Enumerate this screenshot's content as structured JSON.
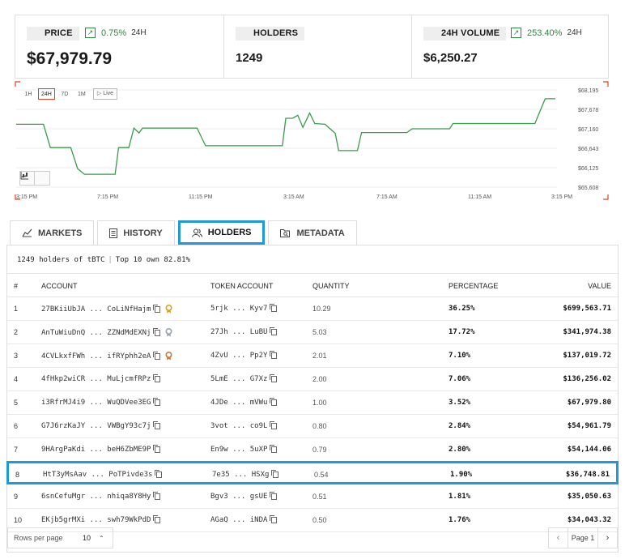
{
  "stats": {
    "price": {
      "label": "PRICE",
      "change": "0.75%",
      "period": "24H",
      "value": "$67,979.79"
    },
    "holders": {
      "label": "HOLDERS",
      "value": "1249"
    },
    "volume": {
      "label": "24H VOLUME",
      "change": "253.40%",
      "period": "24H",
      "value": "$6,250.27"
    }
  },
  "chart_controls": {
    "ranges": [
      "1H",
      "24H",
      "7D",
      "1M"
    ],
    "active_range": "24H",
    "live_label": "Live"
  },
  "chart_data": {
    "type": "line",
    "title": "",
    "xlabel": "",
    "ylabel": "",
    "x_tick_labels": [
      "3:15 PM",
      "7:15 PM",
      "11:15 PM",
      "3:15 AM",
      "7:15 AM",
      "11:15 AM",
      "3:15 PM"
    ],
    "y_tick_labels": [
      "$68,195",
      "$67,678",
      "$67,160",
      "$66,643",
      "$66,125",
      "$65,608"
    ],
    "ylim": [
      65608,
      68195
    ],
    "grid": true,
    "line_color": "#3a9a4e",
    "series": [
      {
        "values": [
          [
            0.0,
            67280
          ],
          [
            0.8,
            67280
          ],
          [
            1.0,
            66660
          ],
          [
            1.6,
            66660
          ],
          [
            1.8,
            66100
          ],
          [
            2.0,
            65950
          ],
          [
            2.9,
            65950
          ],
          [
            3.0,
            66660
          ],
          [
            3.3,
            66660
          ],
          [
            3.45,
            67180
          ],
          [
            3.6,
            67050
          ],
          [
            3.7,
            67180
          ],
          [
            5.3,
            67180
          ],
          [
            5.55,
            66710
          ],
          [
            7.8,
            66710
          ],
          [
            7.9,
            67440
          ],
          [
            8.1,
            67440
          ],
          [
            8.25,
            67520
          ],
          [
            8.4,
            67200
          ],
          [
            8.6,
            67580
          ],
          [
            8.75,
            67300
          ],
          [
            9.05,
            67280
          ],
          [
            9.35,
            67040
          ],
          [
            9.45,
            66580
          ],
          [
            10.0,
            66580
          ],
          [
            10.12,
            67060
          ],
          [
            11.45,
            67060
          ],
          [
            11.6,
            67160
          ],
          [
            12.7,
            67160
          ],
          [
            12.8,
            67300
          ],
          [
            15.2,
            67300
          ],
          [
            15.5,
            67960
          ],
          [
            15.8,
            67960
          ]
        ]
      }
    ]
  },
  "tabs": [
    {
      "label": "MARKETS"
    },
    {
      "label": "HISTORY"
    },
    {
      "label": "HOLDERS"
    },
    {
      "label": "METADATA"
    }
  ],
  "active_tab": "HOLDERS",
  "summary": {
    "holders_text": "1249 holders of tBTC",
    "top10_text": "Top 10 own 82.81%"
  },
  "table": {
    "headers": {
      "num": "#",
      "account": "ACCOUNT",
      "token_account": "TOKEN ACCOUNT",
      "quantity": "QUANTITY",
      "percentage": "PERCENTAGE",
      "value": "VALUE"
    },
    "rows": [
      {
        "num": "1",
        "account": "27BKiiUbJA ... CoLiNfHajm",
        "token": "5rjk ... Kyv7",
        "qty": "10.29",
        "pct": "36.25%",
        "value": "$699,563.71",
        "medal": "gold"
      },
      {
        "num": "2",
        "account": "AnTuWiuDnQ ... ZZNdMdEXNj",
        "token": "27Jh ... LuBU",
        "qty": "5.03",
        "pct": "17.72%",
        "value": "$341,974.38",
        "medal": "silver"
      },
      {
        "num": "3",
        "account": "4CVLkxfFWh ... ifRYphh2eA",
        "token": "4ZvU ... Pp2Y",
        "qty": "2.01",
        "pct": "7.10%",
        "value": "$137,019.72",
        "medal": "bronze"
      },
      {
        "num": "4",
        "account": "4fHkp2wiCR ... MuLjcmfRPz",
        "token": "5LmE ... G7Xz",
        "qty": "2.00",
        "pct": "7.06%",
        "value": "$136,256.02",
        "medal": ""
      },
      {
        "num": "5",
        "account": "i3RfrMJ4i9 ... WuQDVee3EG",
        "token": "4JDe ... mVWu",
        "qty": "1.00",
        "pct": "3.52%",
        "value": "$67,979.80",
        "medal": ""
      },
      {
        "num": "6",
        "account": "G7J6rzKaJY ... VWBgY93c7j",
        "token": "3vot ... co9L",
        "qty": "0.80",
        "pct": "2.84%",
        "value": "$54,961.79",
        "medal": ""
      },
      {
        "num": "7",
        "account": "9HArgPaKdi ... beH6ZbME9P",
        "token": "En9w ... 5uXP",
        "qty": "0.79",
        "pct": "2.80%",
        "value": "$54,144.06",
        "medal": ""
      },
      {
        "num": "8",
        "account": "HtT3yMsAav ... PoTPivde3s",
        "token": "7e35 ... HSXg",
        "qty": "0.54",
        "pct": "1.90%",
        "value": "$36,748.81",
        "medal": ""
      },
      {
        "num": "9",
        "account": "6snCefuMgr ... nhiqa8Y8Hy",
        "token": "Bgv3 ... gsUE",
        "qty": "0.51",
        "pct": "1.81%",
        "value": "$35,050.63",
        "medal": ""
      },
      {
        "num": "10",
        "account": "EKjb5grMXi ... swh79WkPdD",
        "token": "AGaQ ... iNDA",
        "qty": "0.50",
        "pct": "1.76%",
        "value": "$34,043.32",
        "medal": ""
      }
    ]
  },
  "pagination": {
    "rows_per_page_label": "Rows per page",
    "rows_per_page": "10",
    "page_label": "Page 1"
  },
  "colors": {
    "accent": "#1f9ad6",
    "positive": "#2a8a3e",
    "line": "#3a9a4e",
    "range_active": "#e04020"
  }
}
